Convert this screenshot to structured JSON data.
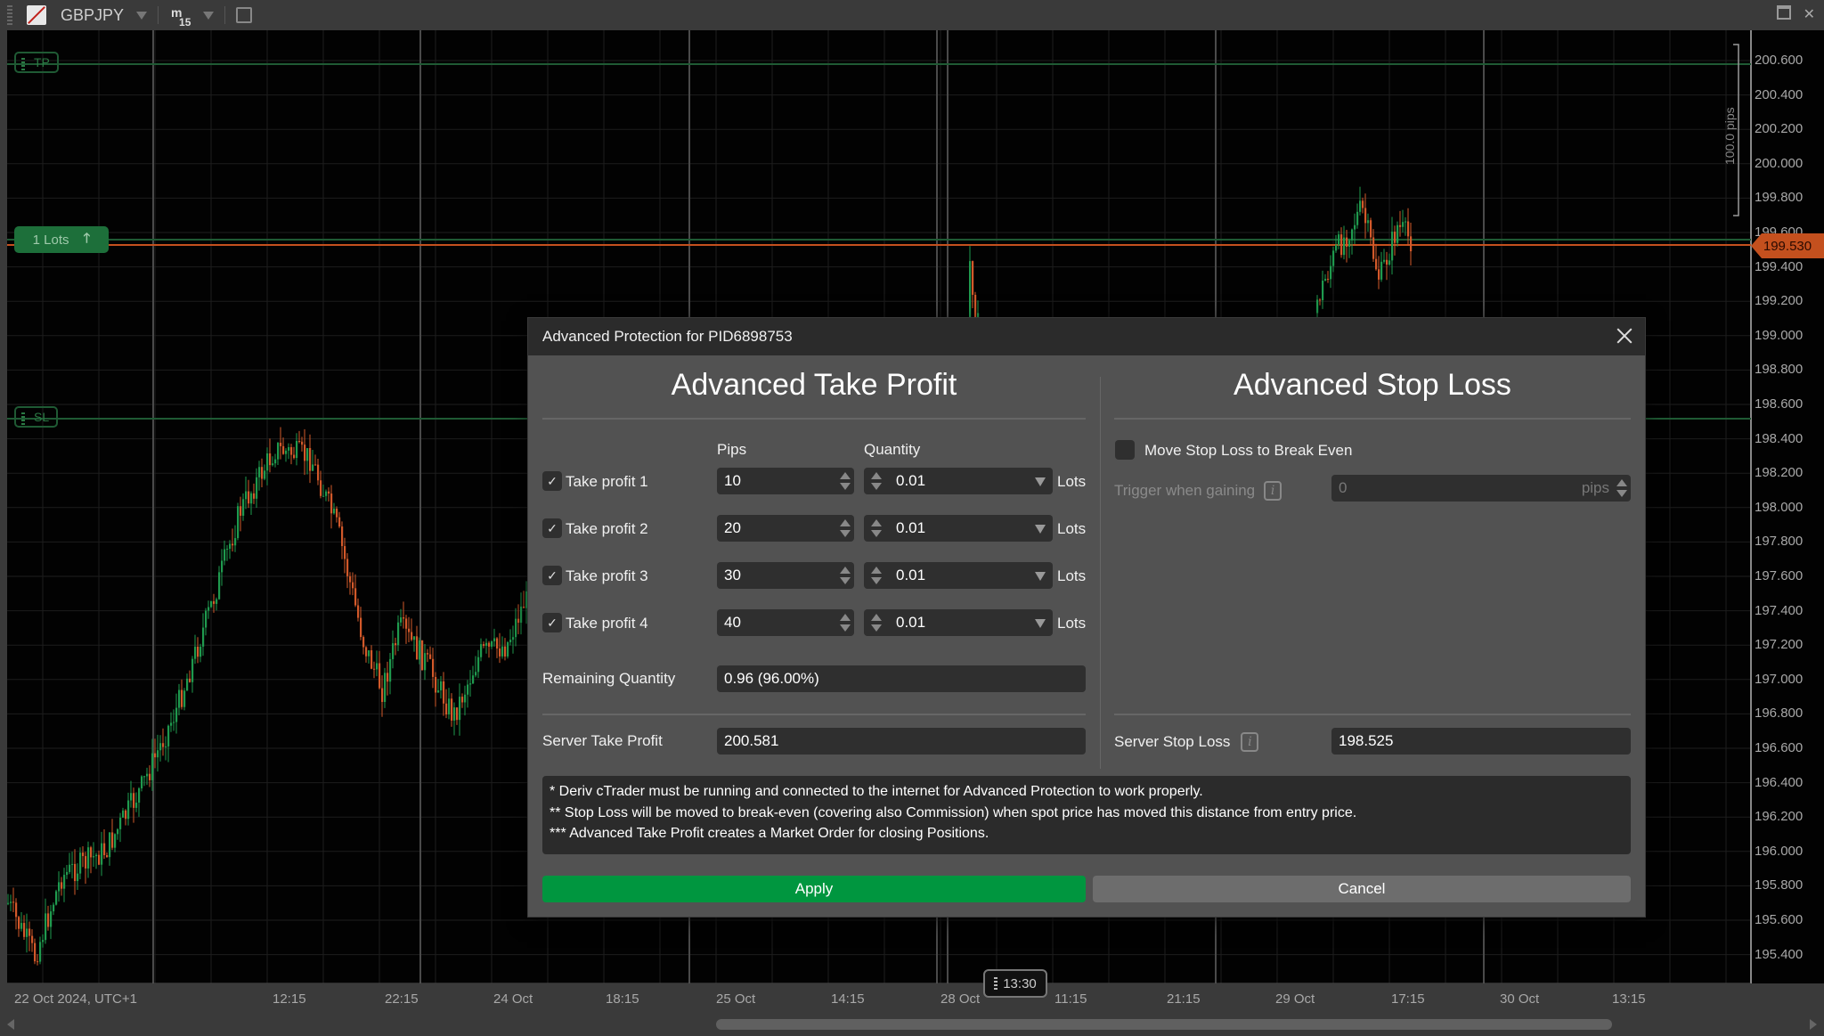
{
  "toolbar": {
    "symbol": "GBPJPY",
    "timeframe_prefix": "m",
    "timeframe_value": "15",
    "icons": [
      "drag-grip-icon",
      "symbol-icon",
      "dropdown-arrow-icon",
      "timeframe-icon",
      "cast-icon",
      "maximize-icon",
      "close-icon"
    ]
  },
  "chart": {
    "tp_tag": "TP",
    "sl_tag": "SL",
    "position_tag": "1 Lots",
    "current_price": "199.530",
    "pips_ruler": "100.0 pips",
    "time_marker": "13:30",
    "colors": {
      "bull": "#1f9a4e",
      "bear": "#d2592a",
      "tp_line": "#1f5a34",
      "price_line": "#c4501e",
      "background": "#020202"
    },
    "y_labels": [
      "200.600",
      "200.400",
      "200.200",
      "200.000",
      "199.800",
      "199.600",
      "199.400",
      "199.200",
      "199.000",
      "198.800",
      "198.600",
      "198.400",
      "198.200",
      "198.000",
      "197.800",
      "197.600",
      "197.400",
      "197.200",
      "197.000",
      "196.800",
      "196.600",
      "196.400",
      "196.200",
      "196.000",
      "195.800",
      "195.600",
      "195.400"
    ],
    "x_labels": [
      "22 Oct 2024, UTC+1",
      "12:15",
      "22:15",
      "24 Oct",
      "18:15",
      "25 Oct",
      "14:15",
      "28 Oct",
      "11:15",
      "21:15",
      "29 Oct",
      "17:15",
      "30 Oct",
      "13:15"
    ]
  },
  "dialog": {
    "title": "Advanced Protection for PID6898753",
    "tp": {
      "heading": "Advanced Take Profit",
      "col_pips": "Pips",
      "col_quantity": "Quantity",
      "unit": "Lots",
      "rows": [
        {
          "label": "Take profit 1",
          "checked": true,
          "pips": "10",
          "quantity": "0.01"
        },
        {
          "label": "Take profit 2",
          "checked": true,
          "pips": "20",
          "quantity": "0.01"
        },
        {
          "label": "Take profit 3",
          "checked": true,
          "pips": "30",
          "quantity": "0.01"
        },
        {
          "label": "Take profit 4",
          "checked": true,
          "pips": "40",
          "quantity": "0.01"
        }
      ],
      "remaining_label": "Remaining Quantity",
      "remaining_value": "0.96 (96.00%)",
      "server_label": "Server Take Profit",
      "server_value": "200.581"
    },
    "sl": {
      "heading": "Advanced Stop Loss",
      "break_even_label": "Move Stop Loss to Break Even",
      "break_even_checked": false,
      "trigger_label": "Trigger when gaining",
      "trigger_value": "0",
      "trigger_unit": "pips",
      "server_label": "Server Stop Loss",
      "server_value": "198.525"
    },
    "notes": [
      "* Deriv cTrader must be running and connected to the internet for Advanced Protection to work properly.",
      "** Stop Loss will be moved to break-even (covering also Commission) when spot price has moved this distance from entry price.",
      "*** Advanced Take Profit creates a Market Order for closing Positions."
    ],
    "apply_label": "Apply",
    "cancel_label": "Cancel",
    "check_glyph": "✓",
    "info_glyph": "i"
  }
}
